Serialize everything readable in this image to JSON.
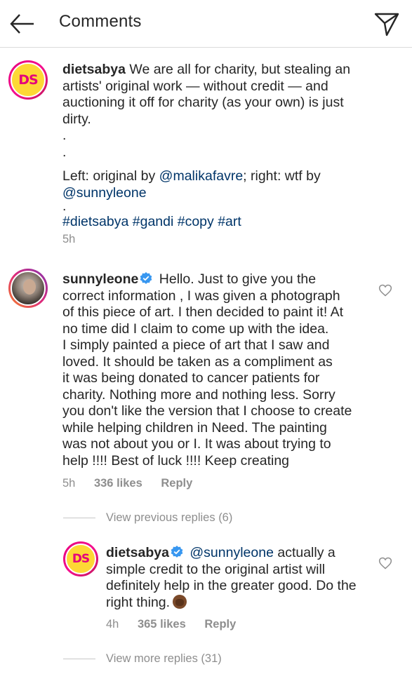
{
  "header": {
    "title": "Comments"
  },
  "comments": [
    {
      "username": "dietsabya",
      "avatar_label": "DS",
      "text_line1": "We are all for charity, but stealing an",
      "text_line2": "artists' original work — without credit — and",
      "text_line3": "auctioning it off for charity (as your own) is just",
      "text_line4": "dirty.",
      "dot1": ".",
      "dot2": ".",
      "text_left_prefix": "Left: original by ",
      "mention_malika": "@malikafavre",
      "text_left_suffix": "; right: wtf by",
      "mention_sunny": "@sunnyleone",
      "dot3": ".",
      "hashtags": [
        "#dietsabya",
        "#gandi",
        "#copy",
        "#art"
      ],
      "time": "5h"
    },
    {
      "username": "sunnyleone",
      "lines": [
        "Hello. Just to give you the",
        "correct information , I was given a photograph",
        "of this piece of art. I then decided to paint it! At",
        "no time did I claim to come up with the idea.",
        "I simply painted a piece of art that I saw and",
        "loved.  It should be taken as a compliment as",
        "it was being donated to cancer patients for",
        "charity.  Nothing more and nothing less.  Sorry",
        "you don't like the version that I choose to create",
        "while helping children in Need.  The painting",
        "was not about you or I. It was about trying to",
        "help !!!! Best of luck !!!! Keep creating"
      ],
      "time": "5h",
      "likes": "336 likes",
      "reply": "Reply"
    }
  ],
  "view_previous_replies": "View previous replies (6)",
  "reply": {
    "username": "dietsabya",
    "avatar_label": "DS",
    "mention": "@sunnyleone",
    "line1_suffix": " actually a",
    "line2": "simple credit to the original artist will",
    "line3": "definitely help in the greater good. Do the",
    "line4": "right thing.",
    "time": "4h",
    "likes": "365 likes",
    "reply_label": "Reply"
  },
  "view_more_replies": "View more replies (31)",
  "colors": {
    "text": "#262626",
    "muted": "#8e8e8e",
    "link": "#003569",
    "verified": "#3897f0"
  }
}
